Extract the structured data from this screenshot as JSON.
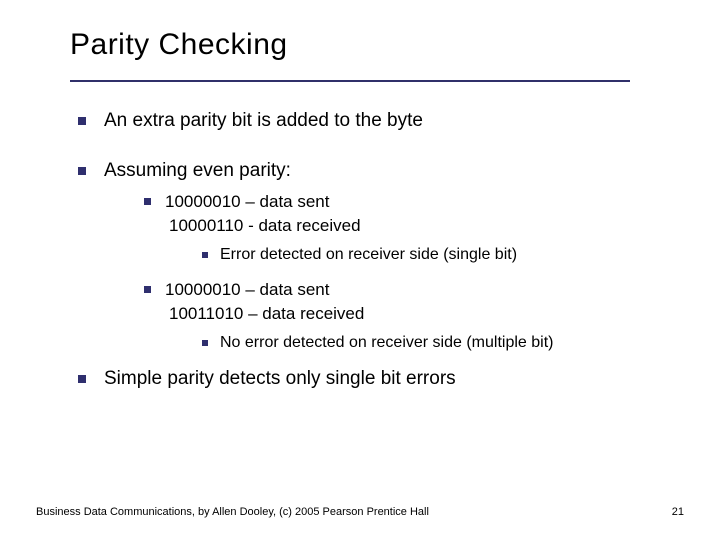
{
  "title": "Parity Checking",
  "bullets": {
    "item1": "An extra parity bit is added to the byte",
    "item2": "Assuming even parity:",
    "sub1_line1": "10000010 – data sent",
    "sub1_line2": "10000110 - data received",
    "sub1_detail": "Error detected on receiver side (single bit)",
    "sub2_line1": "10000010 – data sent",
    "sub2_line2": "10011010 – data received",
    "sub2_detail": "No error detected on receiver side (multiple bit)",
    "item3": "Simple parity detects only single bit errors"
  },
  "footer": "Business Data Communications, by Allen Dooley, (c) 2005 Pearson Prentice Hall",
  "page_number": "21"
}
